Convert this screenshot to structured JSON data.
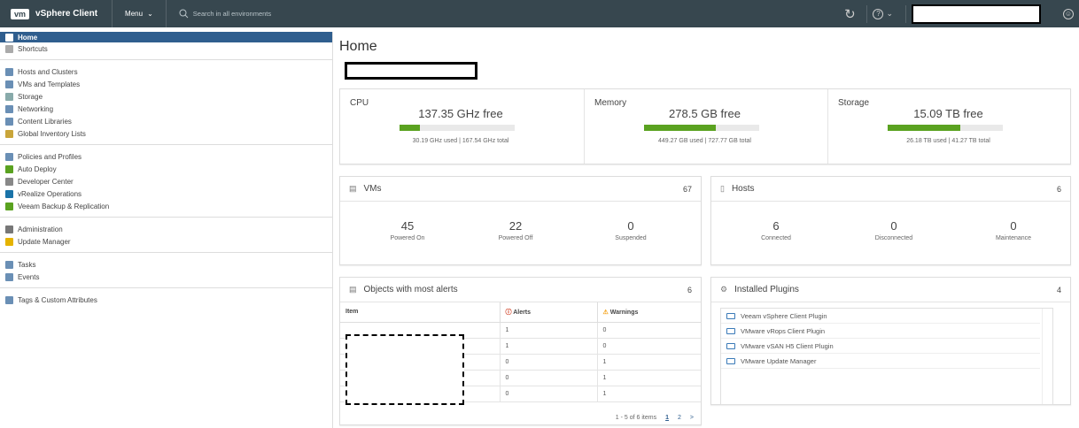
{
  "header": {
    "logo": "vm",
    "title": "vSphere Client",
    "menu_label": "Menu",
    "search_placeholder": "Search in all environments"
  },
  "sidebar": {
    "groups": [
      [
        {
          "label": "Home",
          "icon": "home-icon"
        },
        {
          "label": "Shortcuts",
          "icon": "shortcuts-icon"
        }
      ],
      [
        {
          "label": "Hosts and Clusters",
          "icon": "hosts-icon"
        },
        {
          "label": "VMs and Templates",
          "icon": "vm-icon"
        },
        {
          "label": "Storage",
          "icon": "storage-icon"
        },
        {
          "label": "Networking",
          "icon": "network-icon"
        },
        {
          "label": "Content Libraries",
          "icon": "library-icon"
        },
        {
          "label": "Global Inventory Lists",
          "icon": "list-icon"
        }
      ],
      [
        {
          "label": "Policies and Profiles",
          "icon": "policy-icon"
        },
        {
          "label": "Auto Deploy",
          "icon": "deploy-icon"
        },
        {
          "label": "Developer Center",
          "icon": "code-icon"
        },
        {
          "label": "vRealize Operations",
          "icon": "vrealize-icon"
        },
        {
          "label": "Veeam Backup & Replication",
          "icon": "veeam-icon"
        }
      ],
      [
        {
          "label": "Administration",
          "icon": "admin-icon"
        },
        {
          "label": "Update Manager",
          "icon": "update-icon"
        }
      ],
      [
        {
          "label": "Tasks",
          "icon": "tasks-icon"
        },
        {
          "label": "Events",
          "icon": "events-icon"
        }
      ],
      [
        {
          "label": "Tags & Custom Attributes",
          "icon": "tag-icon"
        }
      ]
    ]
  },
  "main": {
    "title": "Home",
    "resources": [
      {
        "name": "CPU",
        "free": "137.35 GHz free",
        "used": "30.19 GHz used | 167.54 GHz total",
        "fraction": 0.18
      },
      {
        "name": "Memory",
        "free": "278.5 GB free",
        "used": "449.27 GB used | 727.77 GB total",
        "fraction": 0.62
      },
      {
        "name": "Storage",
        "free": "15.09 TB free",
        "used": "26.18 TB used | 41.27 TB total",
        "fraction": 0.63
      }
    ],
    "vms": {
      "title": "VMs",
      "count": "67",
      "stats": [
        {
          "value": "45",
          "label": "Powered On"
        },
        {
          "value": "22",
          "label": "Powered Off"
        },
        {
          "value": "0",
          "label": "Suspended"
        }
      ]
    },
    "hosts": {
      "title": "Hosts",
      "count": "6",
      "stats": [
        {
          "value": "6",
          "label": "Connected"
        },
        {
          "value": "0",
          "label": "Disconnected"
        },
        {
          "value": "0",
          "label": "Maintenance"
        }
      ]
    },
    "alerts": {
      "title": "Objects with most alerts",
      "count": "6",
      "col_item": "Item",
      "col_alerts": "Alerts",
      "col_warnings": "Warnings",
      "rows": [
        [
          "1",
          "0"
        ],
        [
          "1",
          "0"
        ],
        [
          "0",
          "1"
        ],
        [
          "0",
          "1"
        ],
        [
          "0",
          "1"
        ]
      ],
      "pager_text": "1 - 5 of 6 items",
      "pages": [
        "1",
        "2"
      ],
      "next": ">"
    },
    "plugins": {
      "title": "Installed Plugins",
      "count": "4",
      "items": [
        "Veeam vSphere Client Plugin",
        "VMware vRops Client Plugin",
        "VMware vSAN H5 Client Plugin",
        "VMware Update Manager"
      ]
    }
  },
  "colors": {
    "header_bg": "#37474f",
    "active_nav": "#2f5e8e",
    "bar_fill": "#5aa220"
  }
}
